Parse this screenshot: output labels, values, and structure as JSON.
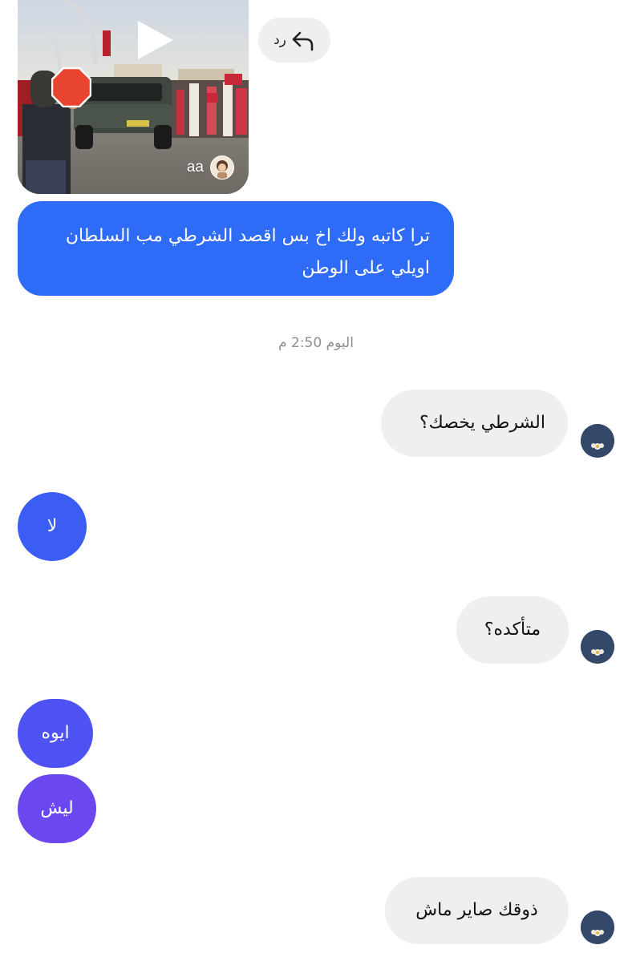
{
  "shared_video": {
    "sharer_name": "aa"
  },
  "reply_button": {
    "label": "رد"
  },
  "messages": [
    {
      "side": "sent",
      "text": "ترا كاتبه ولك اخ بس اقصد الشرطي مب السلطان اويلي على الوطن"
    },
    {
      "side": "received",
      "text": "الشرطي يخصك؟"
    },
    {
      "side": "sent",
      "text": "لا"
    },
    {
      "side": "received",
      "text": "متأكده؟"
    },
    {
      "side": "sent",
      "text": "ايوه"
    },
    {
      "side": "sent",
      "text": "ليش"
    },
    {
      "side": "received",
      "text": "ذوقك صاير ماش"
    }
  ],
  "timestamp": "اليوم 2:50 م",
  "colors": {
    "sent_bubble_1": "#2e6cf7",
    "sent_bubble_2": "#3b5df4",
    "sent_bubble_3": "#4f52f2",
    "sent_bubble_4": "#6b47f0",
    "received_bubble": "#efefef",
    "timestamp_text": "#8e8e8e"
  },
  "icons": [
    "play-icon",
    "stop-sign-icon",
    "reply-arrow-icon"
  ]
}
